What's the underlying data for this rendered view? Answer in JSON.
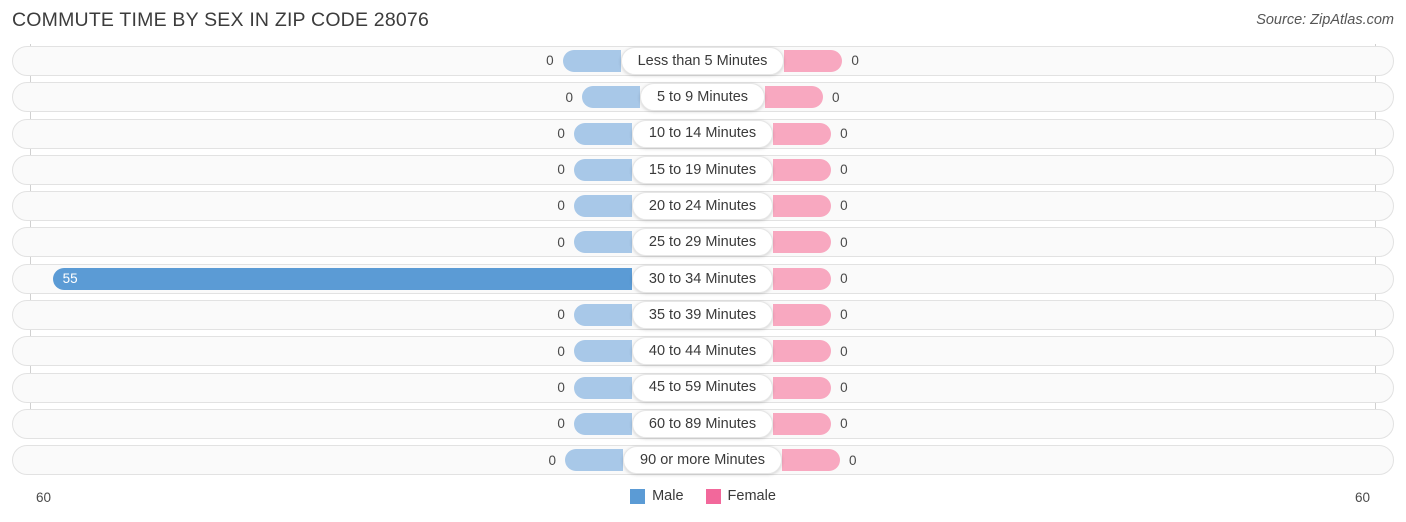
{
  "header": {
    "title": "COMMUTE TIME BY SEX IN ZIP CODE 28076",
    "source": "Source: ZipAtlas.com"
  },
  "legend": {
    "male_label": "Male",
    "female_label": "Female",
    "male_color": "#5b9bd5",
    "female_color": "#f2689b"
  },
  "axis": {
    "left_max": "60",
    "right_max": "60"
  },
  "colors": {
    "male_empty": "#a8c8e8",
    "male_filled": "#5b9bd5",
    "female_empty": "#f8a8c0",
    "female_filled": "#f2689b"
  },
  "chart_data": {
    "type": "bar",
    "title": "COMMUTE TIME BY SEX IN ZIP CODE 28076",
    "subtitle": "Source: ZipAtlas.com",
    "orientation": "horizontal-diverging",
    "xlabel": "",
    "ylabel": "",
    "xlim": [
      60,
      60
    ],
    "grid": false,
    "legend_position": "bottom-center",
    "categories": [
      "Less than 5 Minutes",
      "5 to 9 Minutes",
      "10 to 14 Minutes",
      "15 to 19 Minutes",
      "20 to 24 Minutes",
      "25 to 29 Minutes",
      "30 to 34 Minutes",
      "35 to 39 Minutes",
      "40 to 44 Minutes",
      "45 to 59 Minutes",
      "60 to 89 Minutes",
      "90 or more Minutes"
    ],
    "series": [
      {
        "name": "Male",
        "direction": "left",
        "values": [
          0,
          0,
          0,
          0,
          0,
          0,
          55,
          0,
          0,
          0,
          0,
          0
        ]
      },
      {
        "name": "Female",
        "direction": "right",
        "values": [
          0,
          0,
          0,
          0,
          0,
          0,
          0,
          0,
          0,
          0,
          0,
          0
        ]
      }
    ]
  },
  "rows": [
    {
      "category": "Less than 5 Minutes",
      "male": "0",
      "female": "0"
    },
    {
      "category": "5 to 9 Minutes",
      "male": "0",
      "female": "0"
    },
    {
      "category": "10 to 14 Minutes",
      "male": "0",
      "female": "0"
    },
    {
      "category": "15 to 19 Minutes",
      "male": "0",
      "female": "0"
    },
    {
      "category": "20 to 24 Minutes",
      "male": "0",
      "female": "0"
    },
    {
      "category": "25 to 29 Minutes",
      "male": "0",
      "female": "0"
    },
    {
      "category": "30 to 34 Minutes",
      "male": "55",
      "female": "0"
    },
    {
      "category": "35 to 39 Minutes",
      "male": "0",
      "female": "0"
    },
    {
      "category": "40 to 44 Minutes",
      "male": "0",
      "female": "0"
    },
    {
      "category": "45 to 59 Minutes",
      "male": "0",
      "female": "0"
    },
    {
      "category": "60 to 89 Minutes",
      "male": "0",
      "female": "0"
    },
    {
      "category": "90 or more Minutes",
      "male": "0",
      "female": "0"
    }
  ]
}
